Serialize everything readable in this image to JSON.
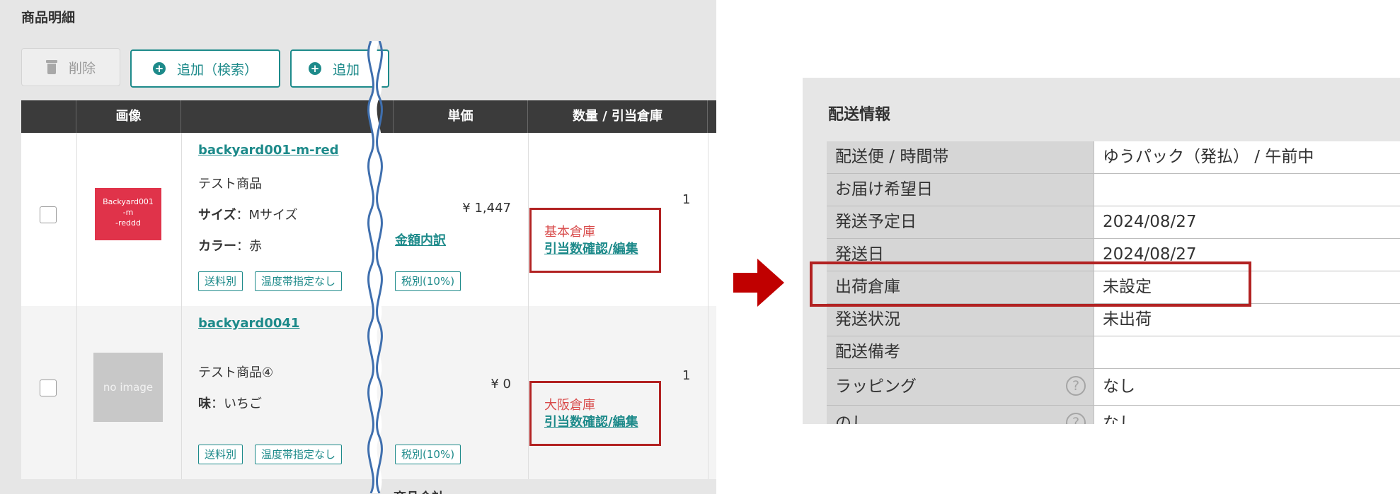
{
  "left": {
    "section_title": "商品明細",
    "buttons": {
      "delete": "削除",
      "add_search": "追加（検索）",
      "add": "追加"
    },
    "columns": {
      "image": "画像",
      "unit_price": "単価",
      "qty_warehouse": "数量 / 引当倉庫"
    },
    "rows": [
      {
        "thumb_text_1": "Backyard001",
        "thumb_text_2": "-m",
        "thumb_text_3": "-reddd",
        "sku": "backyard001-m-red",
        "name": "テスト商品",
        "attr1_label": "サイズ",
        "attr1_value": "：Mサイズ",
        "attr2_label": "カラー",
        "attr2_value": "：赤",
        "tag1": "送料別",
        "tag2": "温度帯指定なし",
        "price": "¥ 1,447",
        "price_breakdown": "金額内訳",
        "tax_tag": "税別(10%)",
        "qty": "1",
        "warehouse": "基本倉庫",
        "warehouse_link": "引当数確認/編集"
      },
      {
        "thumb_text": "no image",
        "sku": "backyard0041",
        "name": "テスト商品④",
        "attr1_label": "味",
        "attr1_value": "：いちご",
        "tag1": "送料別",
        "tag2": "温度帯指定なし",
        "price": "¥ 0",
        "tax_tag": "税別(10%)",
        "qty": "1",
        "warehouse": "大阪倉庫",
        "warehouse_link": "引当数確認/編集"
      }
    ],
    "bottom_label": "商品合計"
  },
  "right": {
    "title": "配送情報",
    "rows": [
      {
        "label": "配送便 / 時間帯",
        "value": "ゆうパック（発払） / 午前中"
      },
      {
        "label": "お届け希望日",
        "value": ""
      },
      {
        "label": "発送予定日",
        "value": "2024/08/27"
      },
      {
        "label": "発送日",
        "value": "2024/08/27"
      },
      {
        "label": "出荷倉庫",
        "value": "未設定"
      },
      {
        "label": "発送状況",
        "value": "未出荷"
      },
      {
        "label": "配送備考",
        "value": ""
      },
      {
        "label": "ラッピング",
        "value": "なし"
      },
      {
        "label": "のし",
        "value": "なし"
      }
    ]
  },
  "colors": {
    "accent": "#1d8a8a",
    "highlight": "#b22222",
    "arrow": "#c00000",
    "header_bg": "#3b3b3b",
    "thumb_red": "#e0334a"
  }
}
